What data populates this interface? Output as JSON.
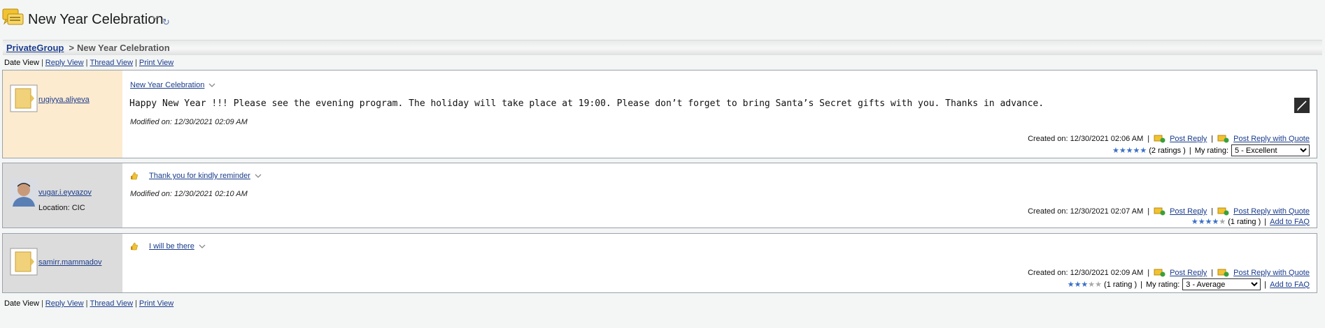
{
  "header": {
    "title": "New Year Celebration",
    "icon": "discussion-folder-icon"
  },
  "breadcrumb": {
    "root": "PrivateGroup",
    "separator": ">",
    "current": "New Year Celebration"
  },
  "views": {
    "date": "Date View",
    "reply": "Reply View",
    "thread": "Thread View",
    "print": "Print View",
    "sep": "|"
  },
  "posts": [
    {
      "author": "rugiyya.aliyeva",
      "subject": "New Year Celebration",
      "body": "Happy New Year !!! Please see the evening program. The holiday will take place at 19:00. Please don’t forget to bring Santa’s Secret gifts with you. Thanks in advance.",
      "modified": "Modified on: 12/30/2021 02:09 AM",
      "created": "Created on: 12/30/2021 02:06 AM",
      "post_reply": "Post Reply",
      "post_reply_quote": "Post Reply with Quote",
      "stars": 5,
      "ratings_text": "(2 ratings )",
      "my_rating_label": "My rating:",
      "my_rating_value": "5 - Excellent"
    },
    {
      "author": "vugar.i.eyvazov",
      "location": "Location: CIC",
      "subject": "Thank you for kindly reminder",
      "modified": "Modified on: 12/30/2021 02:10 AM",
      "created": "Created on: 12/30/2021 02:07 AM",
      "post_reply": "Post Reply",
      "post_reply_quote": "Post Reply with Quote",
      "stars": 4,
      "ratings_text": "(1 rating )",
      "add_faq": "Add to FAQ"
    },
    {
      "author": "samirr.mammadov",
      "subject": "I will be there",
      "created": "Created on: 12/30/2021 02:09 AM",
      "post_reply": "Post Reply",
      "post_reply_quote": "Post Reply with Quote",
      "stars": 3,
      "ratings_text": "(1 rating )",
      "my_rating_label": "My rating:",
      "my_rating_value": "3 - Average",
      "add_faq": "Add to FAQ"
    }
  ],
  "colors": {
    "link": "#1a3c8c",
    "first_post_sidebar": "#fdebd0",
    "other_post_sidebar": "#dcdcdc",
    "star_on": "#3a6fc8",
    "star_off": "#a8a8a8"
  }
}
